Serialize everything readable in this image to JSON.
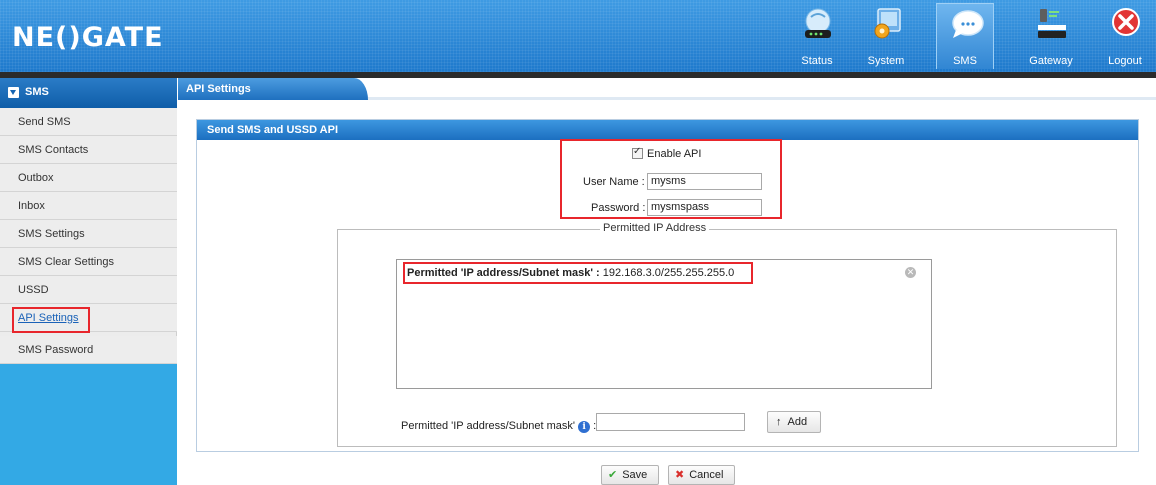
{
  "header": {
    "logo": "NE()GATE",
    "nav": [
      {
        "label": "Status",
        "icon": "status-icon"
      },
      {
        "label": "System",
        "icon": "system-icon"
      },
      {
        "label": "SMS",
        "icon": "sms-icon",
        "active": true
      },
      {
        "label": "Gateway",
        "icon": "gateway-icon"
      },
      {
        "label": "Logout",
        "icon": "logout-icon"
      }
    ]
  },
  "sidebar": {
    "title": "SMS",
    "items": [
      {
        "label": "Send SMS"
      },
      {
        "label": "SMS Contacts"
      },
      {
        "label": "Outbox"
      },
      {
        "label": "Inbox"
      },
      {
        "label": "SMS Settings"
      },
      {
        "label": "SMS Clear Settings"
      },
      {
        "label": "USSD"
      },
      {
        "label": "API Settings",
        "selected": true
      },
      {
        "label": "SMS Password"
      }
    ]
  },
  "tab": {
    "label": "API Settings"
  },
  "panel": {
    "title": "Send SMS and USSD API",
    "enable_api_label": "Enable API",
    "enable_api_checked": true,
    "username_label": "User Name :",
    "username_value": "mysms",
    "password_label": "Password :",
    "password_value": "mysmspass",
    "permitted_legend": "Permitted IP Address",
    "permitted_entry_label": "Permitted 'IP address/Subnet mask' :",
    "permitted_entry_value": "192.168.3.0/255.255.255.0",
    "add_field_label": "Permitted 'IP address/Subnet mask'",
    "add_field_value": "",
    "add_button": "Add",
    "save_button": "Save",
    "cancel_button": "Cancel"
  },
  "colors": {
    "header": "#1e79cc",
    "sidebar_fill": "#33a9e5",
    "highlight": "#e8262c"
  }
}
